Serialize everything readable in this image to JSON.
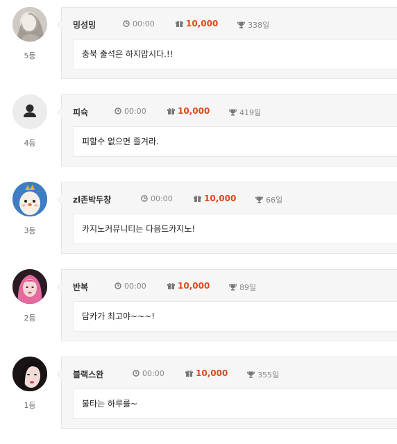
{
  "entries": [
    {
      "name": "밍성밍",
      "time": "00:00",
      "points": "10,000",
      "days": "338일",
      "rank": "5등",
      "message": "충북 출석은 하지맙시다.!!",
      "avatar": "photo-gray"
    },
    {
      "name": "피슉",
      "time": "00:00",
      "points": "10,000",
      "days": "419일",
      "rank": "4등",
      "message": "피할수 없으면 즐겨라.",
      "avatar": "default-user"
    },
    {
      "name": "zl존박두창",
      "time": "00:00",
      "points": "10,000",
      "days": "66일",
      "rank": "3등",
      "message": "카지노커뮤니티는 다음드카지노!",
      "avatar": "egg-character"
    },
    {
      "name": "반복",
      "time": "00:00",
      "points": "10,000",
      "days": "89일",
      "rank": "2등",
      "message": "담카가 최고야~~~!",
      "avatar": "photo-pink"
    },
    {
      "name": "블랙스완",
      "time": "00:00",
      "points": "10,000",
      "days": "355일",
      "rank": "1등",
      "message": "불타는 하루를~",
      "avatar": "photo-dark"
    }
  ],
  "colors": {
    "points": "#e0471b",
    "card_bg": "#f6f6f6",
    "message_bg": "#ffffff"
  },
  "icons": {
    "time": "clock-icon",
    "points": "gift-icon",
    "days": "trophy-icon"
  }
}
